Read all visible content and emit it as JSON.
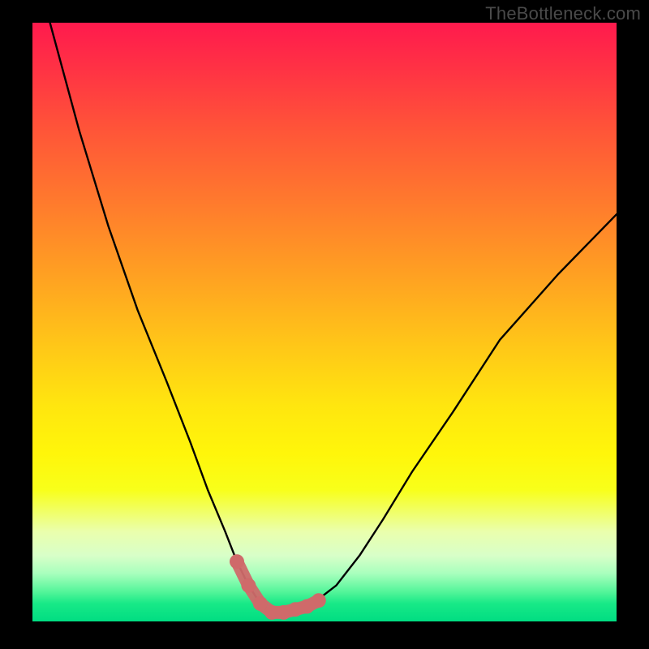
{
  "attribution": "TheBottleneck.com",
  "colors": {
    "frame_background": "#000000",
    "gradient_top": "#ff1a4d",
    "gradient_bottom": "#00dd82",
    "curve": "#000000",
    "marker": "#cf6a6a"
  },
  "chart_data": {
    "type": "line",
    "title": "",
    "xlabel": "",
    "ylabel": "",
    "xlim": [
      0,
      100
    ],
    "ylim": [
      0,
      100
    ],
    "series": [
      {
        "name": "bottleneck-curve",
        "x": [
          3,
          8,
          13,
          18,
          23,
          27,
          30,
          33,
          35,
          37,
          39,
          41,
          43,
          45,
          48,
          52,
          56,
          60,
          65,
          72,
          80,
          90,
          100
        ],
        "values": [
          100,
          82,
          66,
          52,
          40,
          30,
          22,
          15,
          10,
          6,
          3,
          1.5,
          1.5,
          2,
          3,
          6,
          11,
          17,
          25,
          35,
          47,
          58,
          68
        ]
      }
    ],
    "markers": {
      "name": "highlighted-points",
      "x": [
        35,
        37,
        39,
        41,
        43,
        45,
        47,
        49
      ],
      "values": [
        10,
        6,
        3,
        1.5,
        1.5,
        2,
        2.5,
        3.5
      ]
    }
  }
}
